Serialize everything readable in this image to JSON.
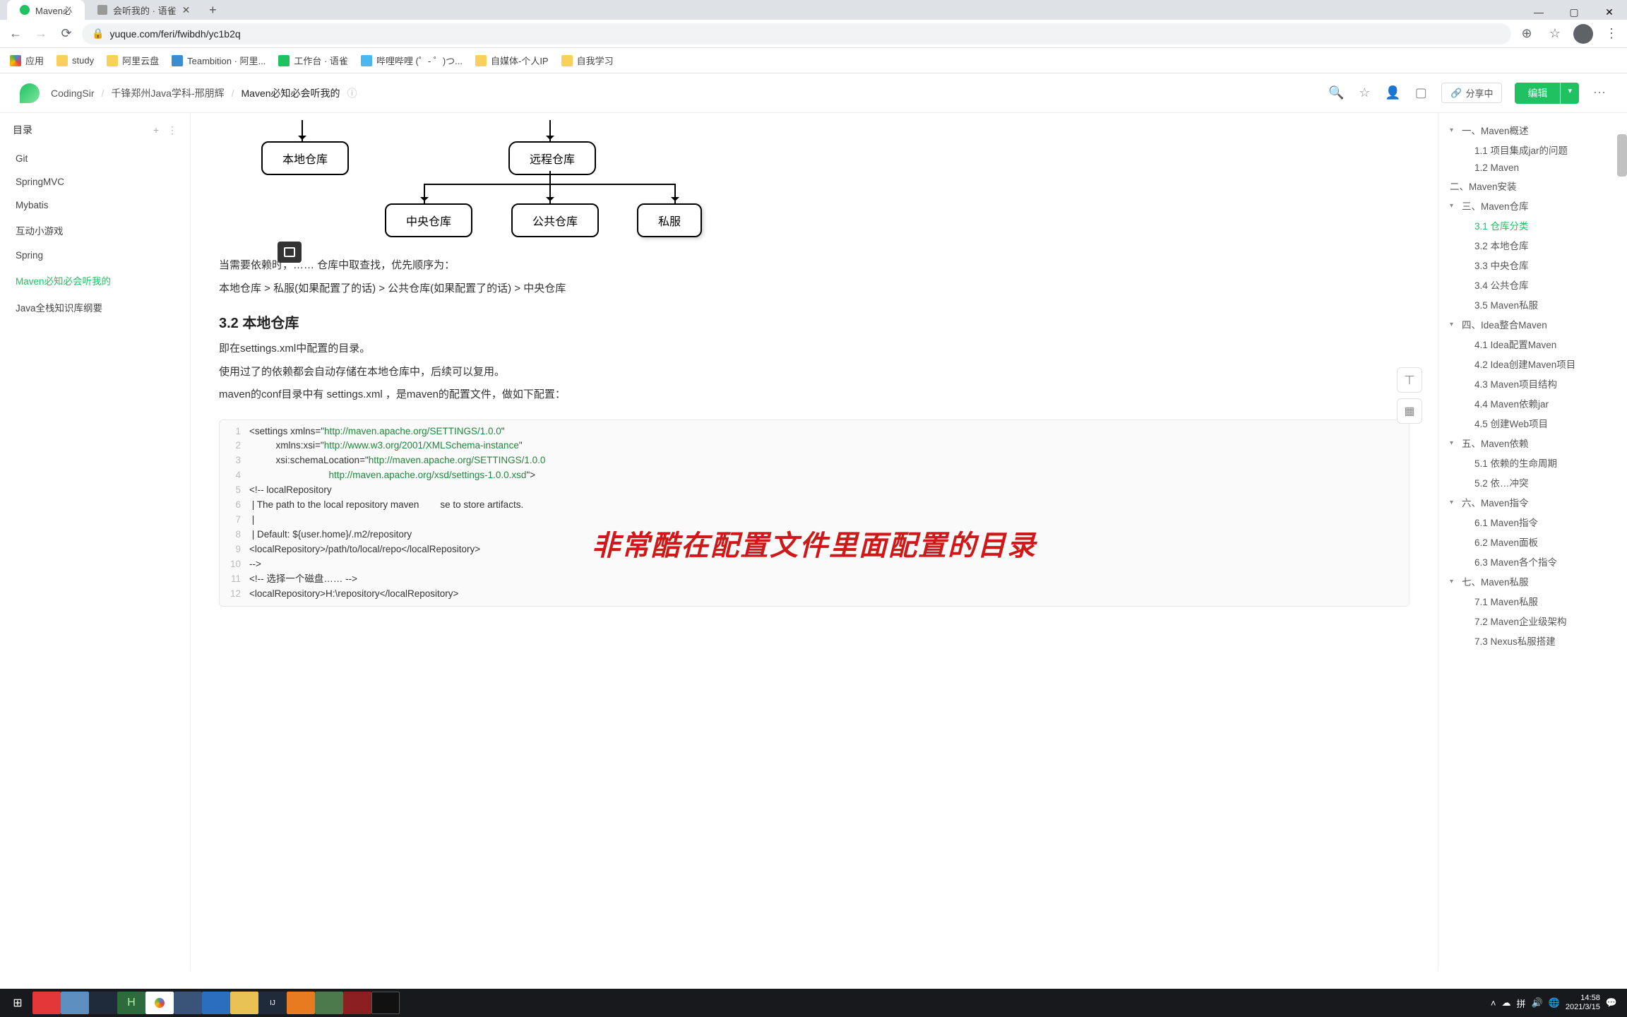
{
  "browser": {
    "tabs": [
      {
        "label": "Maven必"
      },
      {
        "label": "会听我的 · 语雀"
      }
    ],
    "url": "yuque.com/feri/fwibdh/yc1b2q"
  },
  "bookmarks": [
    {
      "label": "应用"
    },
    {
      "label": "study"
    },
    {
      "label": "阿里云盘"
    },
    {
      "label": "Teambition · 阿里..."
    },
    {
      "label": "工作台 · 语雀"
    },
    {
      "label": "哔哩哔哩 (゜- ゜)つ..."
    },
    {
      "label": "自媒体-个人IP"
    },
    {
      "label": "自我学习"
    }
  ],
  "yuque": {
    "crumbs": [
      "CodingSir",
      "千锋郑州Java学科-邢朋辉",
      "Maven必知必会听我的"
    ],
    "share": "分享中",
    "edit": "编辑"
  },
  "sidebar": {
    "title": "目录",
    "items": [
      "Git",
      "SpringMVC",
      "Mybatis",
      "互动小游戏",
      "Spring",
      "Maven必知必会听我的",
      "Java全栈知识库纲要"
    ]
  },
  "content": {
    "boxes": {
      "b1": "本地仓库",
      "b2": "远程仓库",
      "b3": "中央仓库",
      "b4": "公共仓库",
      "b5": "私服"
    },
    "p1": "当需要依赖时，…… 仓库中取查找，优先顺序为：",
    "p2": "本地仓库  >  私服(如果配置了的话)  >  公共仓库(如果配置了的话)  >  中央仓库",
    "h32": "3.2 本地仓库",
    "p3": "即在settings.xml中配置的目录。",
    "p4": "使用过了的依赖都会自动存储在本地仓库中，后续可以复用。",
    "p5": "maven的conf目录中有 settings.xml  ，是maven的配置文件，做如下配置：",
    "subtitle": "非常酷在配置文件里面配置的目录"
  },
  "code": [
    {
      "n": "1",
      "t": "<settings xmlns=\"http://maven.apache.org/SETTINGS/1.0.0\""
    },
    {
      "n": "2",
      "t": "          xmlns:xsi=\"http://www.w3.org/2001/XMLSchema-instance\""
    },
    {
      "n": "3",
      "t": "          xsi:schemaLocation=\"http://maven.apache.org/SETTINGS/1.0.0"
    },
    {
      "n": "4",
      "t": "                              http://maven.apache.org/xsd/settings-1.0.0.xsd\">"
    },
    {
      "n": "5",
      "t": "<!-- localRepository"
    },
    {
      "n": "6",
      "t": " | The path to the local repository maven        se to store artifacts."
    },
    {
      "n": "7",
      "t": " |"
    },
    {
      "n": "8",
      "t": " | Default: ${user.home}/.m2/repository"
    },
    {
      "n": "9",
      "t": "<localRepository>/path/to/local/repo</localRepository>"
    },
    {
      "n": "10",
      "t": "-->"
    },
    {
      "n": "11",
      "t": "<!-- 选择一个磁盘…… -->"
    },
    {
      "n": "12",
      "t": "<localRepository>H:\\repository</localRepository>"
    }
  ],
  "rtoc": [
    {
      "label": "一、Maven概述",
      "l": 1,
      "chev": true
    },
    {
      "label": "1.1 项目集成jar的问题",
      "l": 2
    },
    {
      "label": "1.2 Maven",
      "l": 2
    },
    {
      "label": "二、Maven安装",
      "l": 1
    },
    {
      "label": "三、Maven仓库",
      "l": 1,
      "chev": true
    },
    {
      "label": "3.1 仓库分类",
      "l": 3,
      "active": true
    },
    {
      "label": "3.2 本地仓库",
      "l": 3
    },
    {
      "label": "3.3 中央仓库",
      "l": 3
    },
    {
      "label": "3.4 公共仓库",
      "l": 3
    },
    {
      "label": "3.5 Maven私服",
      "l": 3
    },
    {
      "label": "四、Idea整合Maven",
      "l": 1,
      "chev": true
    },
    {
      "label": "4.1 Idea配置Maven",
      "l": 3
    },
    {
      "label": "4.2 Idea创建Maven项目",
      "l": 3
    },
    {
      "label": "4.3 Maven项目结构",
      "l": 3
    },
    {
      "label": "4.4 Maven依赖jar",
      "l": 3
    },
    {
      "label": "4.5 创建Web项目",
      "l": 3
    },
    {
      "label": "五、Maven依赖",
      "l": 1,
      "chev": true
    },
    {
      "label": "5.1 依赖的生命周期",
      "l": 3
    },
    {
      "label": "5.2 依…冲突",
      "l": 3
    },
    {
      "label": "六、Maven指令",
      "l": 1,
      "chev": true
    },
    {
      "label": "6.1 Maven指令",
      "l": 3
    },
    {
      "label": "6.2 Maven面板",
      "l": 3
    },
    {
      "label": "6.3 Maven各个指令",
      "l": 3
    },
    {
      "label": "七、Maven私服",
      "l": 1,
      "chev": true
    },
    {
      "label": "7.1 Maven私服",
      "l": 3
    },
    {
      "label": "7.2 Maven企业级架构",
      "l": 3
    },
    {
      "label": "7.3 Nexus私服搭建",
      "l": 3
    }
  ],
  "taskbar": {
    "time": "14:58",
    "date": "2021/3/15"
  }
}
